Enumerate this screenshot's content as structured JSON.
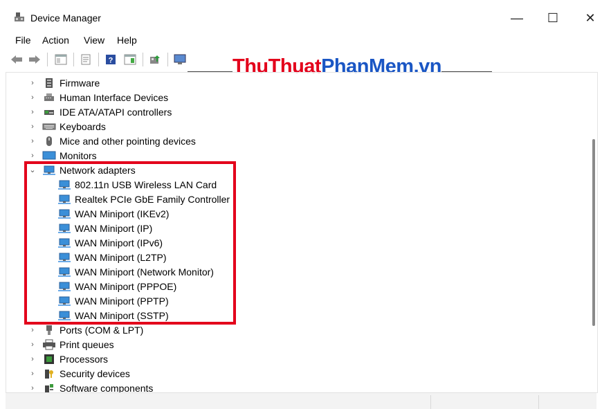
{
  "window": {
    "title": "Device Manager",
    "minimize": "—",
    "maximize": "☐",
    "close": "✕"
  },
  "menu": {
    "items": [
      "File",
      "Action",
      "View",
      "Help"
    ]
  },
  "watermark": {
    "part1": "ThuThuat",
    "part2": "PhanMem",
    "part3": ".vn"
  },
  "tree": {
    "categories": [
      {
        "label": "Firmware",
        "expanded": false,
        "icon": "firmware-icon"
      },
      {
        "label": "Human Interface Devices",
        "expanded": false,
        "icon": "hid-icon"
      },
      {
        "label": "IDE ATA/ATAPI controllers",
        "expanded": false,
        "icon": "ide-controller-icon"
      },
      {
        "label": "Keyboards",
        "expanded": false,
        "icon": "keyboard-icon"
      },
      {
        "label": "Mice and other pointing devices",
        "expanded": false,
        "icon": "mouse-icon"
      },
      {
        "label": "Monitors",
        "expanded": false,
        "icon": "monitor-icon"
      },
      {
        "label": "Network adapters",
        "expanded": true,
        "icon": "network-adapter-icon"
      }
    ],
    "network_adapters": [
      "802.11n USB Wireless LAN Card",
      "Realtek PCIe GbE Family Controller",
      "WAN Miniport (IKEv2)",
      "WAN Miniport (IP)",
      "WAN Miniport (IPv6)",
      "WAN Miniport (L2TP)",
      "WAN Miniport (Network Monitor)",
      "WAN Miniport (PPPOE)",
      "WAN Miniport (PPTP)",
      "WAN Miniport (SSTP)"
    ],
    "after": [
      {
        "label": "Ports (COM & LPT)",
        "expanded": false,
        "icon": "port-icon"
      },
      {
        "label": "Print queues",
        "expanded": false,
        "icon": "printer-icon"
      },
      {
        "label": "Processors",
        "expanded": false,
        "icon": "processor-icon"
      },
      {
        "label": "Security devices",
        "expanded": false,
        "icon": "security-device-icon"
      },
      {
        "label": "Software components",
        "expanded": false,
        "icon": "software-component-icon"
      }
    ]
  },
  "colors": {
    "highlight": "#e3001b",
    "watermark_red": "#e3001b",
    "watermark_blue": "#1a56c4"
  }
}
